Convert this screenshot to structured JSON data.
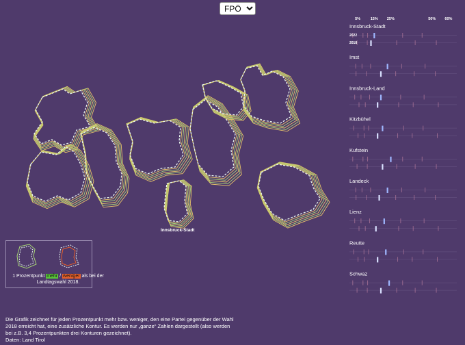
{
  "party_select": {
    "selected": "FPÖ",
    "options": [
      "FPÖ"
    ]
  },
  "map": {
    "city_label": "Innsbruck-Stadt"
  },
  "legend": {
    "text_before": "1 Prozentpunkt ",
    "more": "mehr",
    "sep": " / ",
    "less": "weniger",
    "text_after": " als bei der Landtagswahl 2018."
  },
  "footer": {
    "line1": "Die Grafik zeichnet für jeden Prozentpunkt mehr bzw. weniger, den eine Partei gegenüber der Wahl",
    "line2": "2018 erreicht hat, eine zusätzliche Kontur. Es werden nur „ganze“   Zahlen dargestellt (also werden",
    "line3": "bei z.B. 3,4 Prozentpunkten drei Konturen gezeichnet).",
    "line4": "Daten: Land Tirol"
  },
  "colors": {
    "background": "#4f3a6b",
    "contour_more": "#a8d676",
    "contour_more_alt": "#e9c56a",
    "dashed_outline": "#e6f4ee",
    "mark_2022": "#9fb7ff",
    "mark_2018": "#d9e1ff",
    "mark_other": "#b57a9b"
  },
  "chart_data": {
    "type": "strip",
    "x_ticks": [
      "5%",
      "15%",
      "25%",
      "50%",
      "60%"
    ],
    "year_labels": [
      "2022",
      "2018"
    ],
    "districts": [
      {
        "name": "Innsbruck-Stadt",
        "fpo_2022": 15,
        "fpo_2018": 13
      },
      {
        "name": "Imst",
        "fpo_2022": 23,
        "fpo_2018": 19
      },
      {
        "name": "Innsbruck-Land",
        "fpo_2022": 19,
        "fpo_2018": 17
      },
      {
        "name": "Kitzbühel",
        "fpo_2022": 20,
        "fpo_2018": 17
      },
      {
        "name": "Kufstein",
        "fpo_2022": 25,
        "fpo_2018": 20
      },
      {
        "name": "Landeck",
        "fpo_2022": 23,
        "fpo_2018": 18
      },
      {
        "name": "Lienz",
        "fpo_2022": 21,
        "fpo_2018": 16
      },
      {
        "name": "Reutte",
        "fpo_2022": 22,
        "fpo_2018": 17
      },
      {
        "name": "Schwaz",
        "fpo_2022": 24,
        "fpo_2018": 19
      }
    ]
  }
}
